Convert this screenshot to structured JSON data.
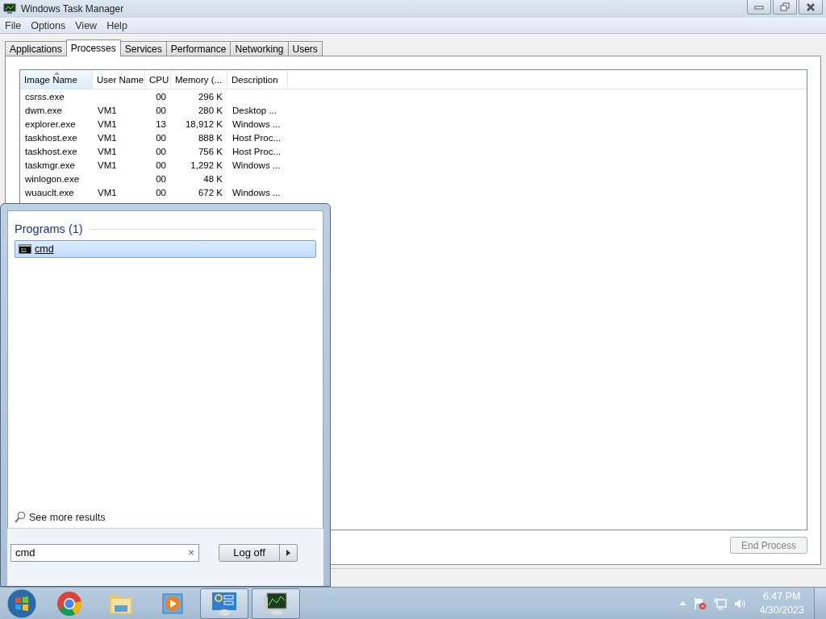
{
  "window": {
    "title": "Windows Task Manager"
  },
  "menu": [
    "File",
    "Options",
    "View",
    "Help"
  ],
  "tabs": [
    {
      "label": "Applications",
      "selected": false
    },
    {
      "label": "Processes",
      "selected": true
    },
    {
      "label": "Services",
      "selected": false
    },
    {
      "label": "Performance",
      "selected": false
    },
    {
      "label": "Networking",
      "selected": false
    },
    {
      "label": "Users",
      "selected": false
    }
  ],
  "table": {
    "columns": [
      {
        "label": "Image Name",
        "sorted": true
      },
      {
        "label": "User Name",
        "sorted": false
      },
      {
        "label": "CPU",
        "sorted": false
      },
      {
        "label": "Memory (...",
        "sorted": false
      },
      {
        "label": "Description",
        "sorted": false
      }
    ],
    "rows": [
      [
        "csrss.exe",
        "",
        "00",
        "296 K",
        ""
      ],
      [
        "dwm.exe",
        "VM1",
        "00",
        "280 K",
        "Desktop ..."
      ],
      [
        "explorer.exe",
        "VM1",
        "13",
        "18,912 K",
        "Windows ..."
      ],
      [
        "taskhost.exe",
        "VM1",
        "00",
        "888 K",
        "Host Proc..."
      ],
      [
        "taskhost.exe",
        "VM1",
        "00",
        "756 K",
        "Host Proc..."
      ],
      [
        "taskmgr.exe",
        "VM1",
        "00",
        "1,292 K",
        "Windows ..."
      ],
      [
        "winlogon.exe",
        "",
        "00",
        "48 K",
        ""
      ],
      [
        "wuauclt.exe",
        "VM1",
        "00",
        "672 K",
        "Windows ..."
      ]
    ]
  },
  "end_process": {
    "label": "End Process",
    "disabled": true
  },
  "start_menu": {
    "section": "Programs (1)",
    "results": [
      {
        "label": "cmd",
        "selected": true
      }
    ],
    "more": "See more results",
    "search": {
      "value": "cmd",
      "clear": "×"
    },
    "power": "Log off"
  },
  "taskbar": {
    "apps": [
      {
        "kind": "start"
      },
      {
        "kind": "browser",
        "open": false
      },
      {
        "kind": "folder",
        "open": false
      },
      {
        "kind": "media",
        "open": false
      },
      {
        "kind": "control-panel",
        "open": true
      },
      {
        "kind": "task-manager",
        "open": true
      }
    ],
    "clock": {
      "time": "6:47 PM",
      "date": "4/30/2023"
    }
  }
}
